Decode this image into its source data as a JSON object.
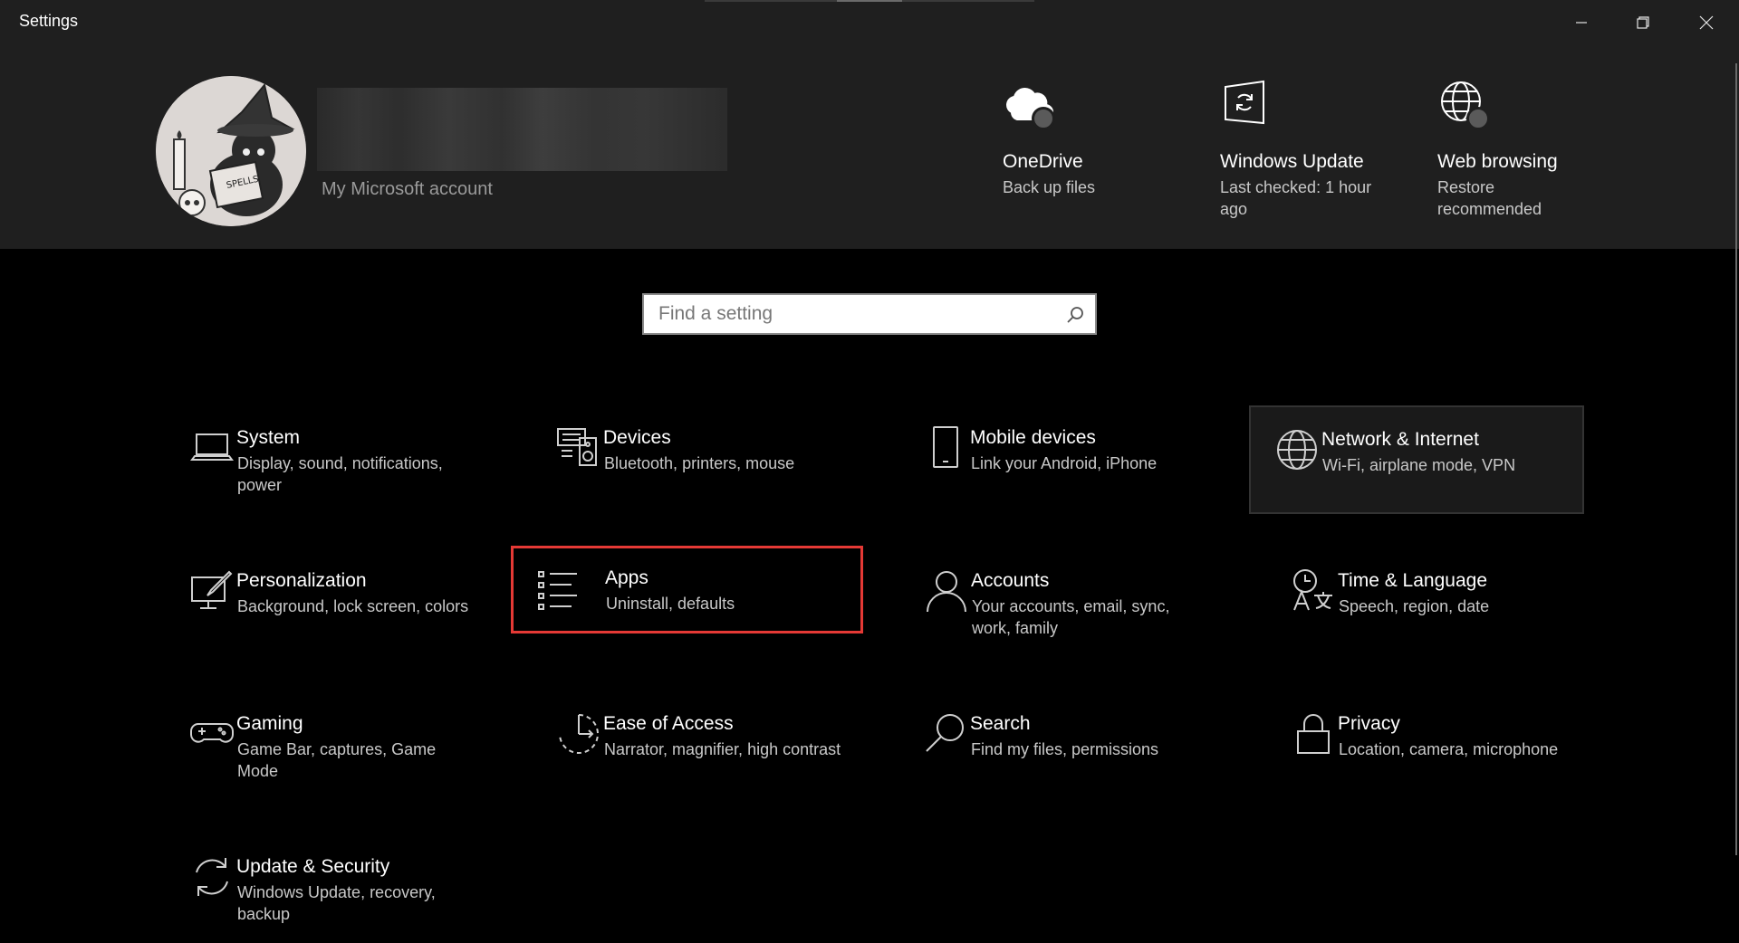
{
  "window": {
    "title": "Settings"
  },
  "header": {
    "account_link": "My Microsoft account",
    "quick_items": [
      {
        "title": "OneDrive",
        "subtitle": "Back up files",
        "icon": "onedrive-cloud-icon"
      },
      {
        "title": "Windows Update",
        "subtitle": "Last checked: 1 hour ago",
        "icon": "windows-update-icon"
      },
      {
        "title": "Web browsing",
        "subtitle": "Restore recommended",
        "icon": "web-globe-icon"
      }
    ]
  },
  "search": {
    "placeholder": "Find a setting"
  },
  "categories": [
    {
      "title": "System",
      "subtitle": "Display, sound, notifications, power",
      "icon": "laptop-icon"
    },
    {
      "title": "Devices",
      "subtitle": "Bluetooth, printers, mouse",
      "icon": "keyboard-speaker-icon"
    },
    {
      "title": "Mobile devices",
      "subtitle": "Link your Android, iPhone",
      "icon": "phone-icon"
    },
    {
      "title": "Network & Internet",
      "subtitle": "Wi-Fi, airplane mode, VPN",
      "icon": "globe-icon"
    },
    {
      "title": "Personalization",
      "subtitle": "Background, lock screen, colors",
      "icon": "paint-brush-icon"
    },
    {
      "title": "Apps",
      "subtitle": "Uninstall, defaults",
      "icon": "apps-list-icon"
    },
    {
      "title": "Accounts",
      "subtitle": "Your accounts, email, sync, work, family",
      "icon": "person-icon"
    },
    {
      "title": "Time & Language",
      "subtitle": "Speech, region, date",
      "icon": "time-language-icon"
    },
    {
      "title": "Gaming",
      "subtitle": "Game Bar, captures, Game Mode",
      "icon": "gamepad-icon"
    },
    {
      "title": "Ease of Access",
      "subtitle": "Narrator, magnifier, high contrast",
      "icon": "ease-of-access-icon"
    },
    {
      "title": "Search",
      "subtitle": "Find my files, permissions",
      "icon": "magnifier-icon"
    },
    {
      "title": "Privacy",
      "subtitle": "Location, camera, microphone",
      "icon": "lock-icon"
    },
    {
      "title": "Update & Security",
      "subtitle": "Windows Update, recovery, backup",
      "icon": "sync-arrows-icon"
    }
  ],
  "colors": {
    "selection_highlight": "#e53935",
    "header_bg": "#1f1f1f",
    "page_bg": "#000000"
  }
}
